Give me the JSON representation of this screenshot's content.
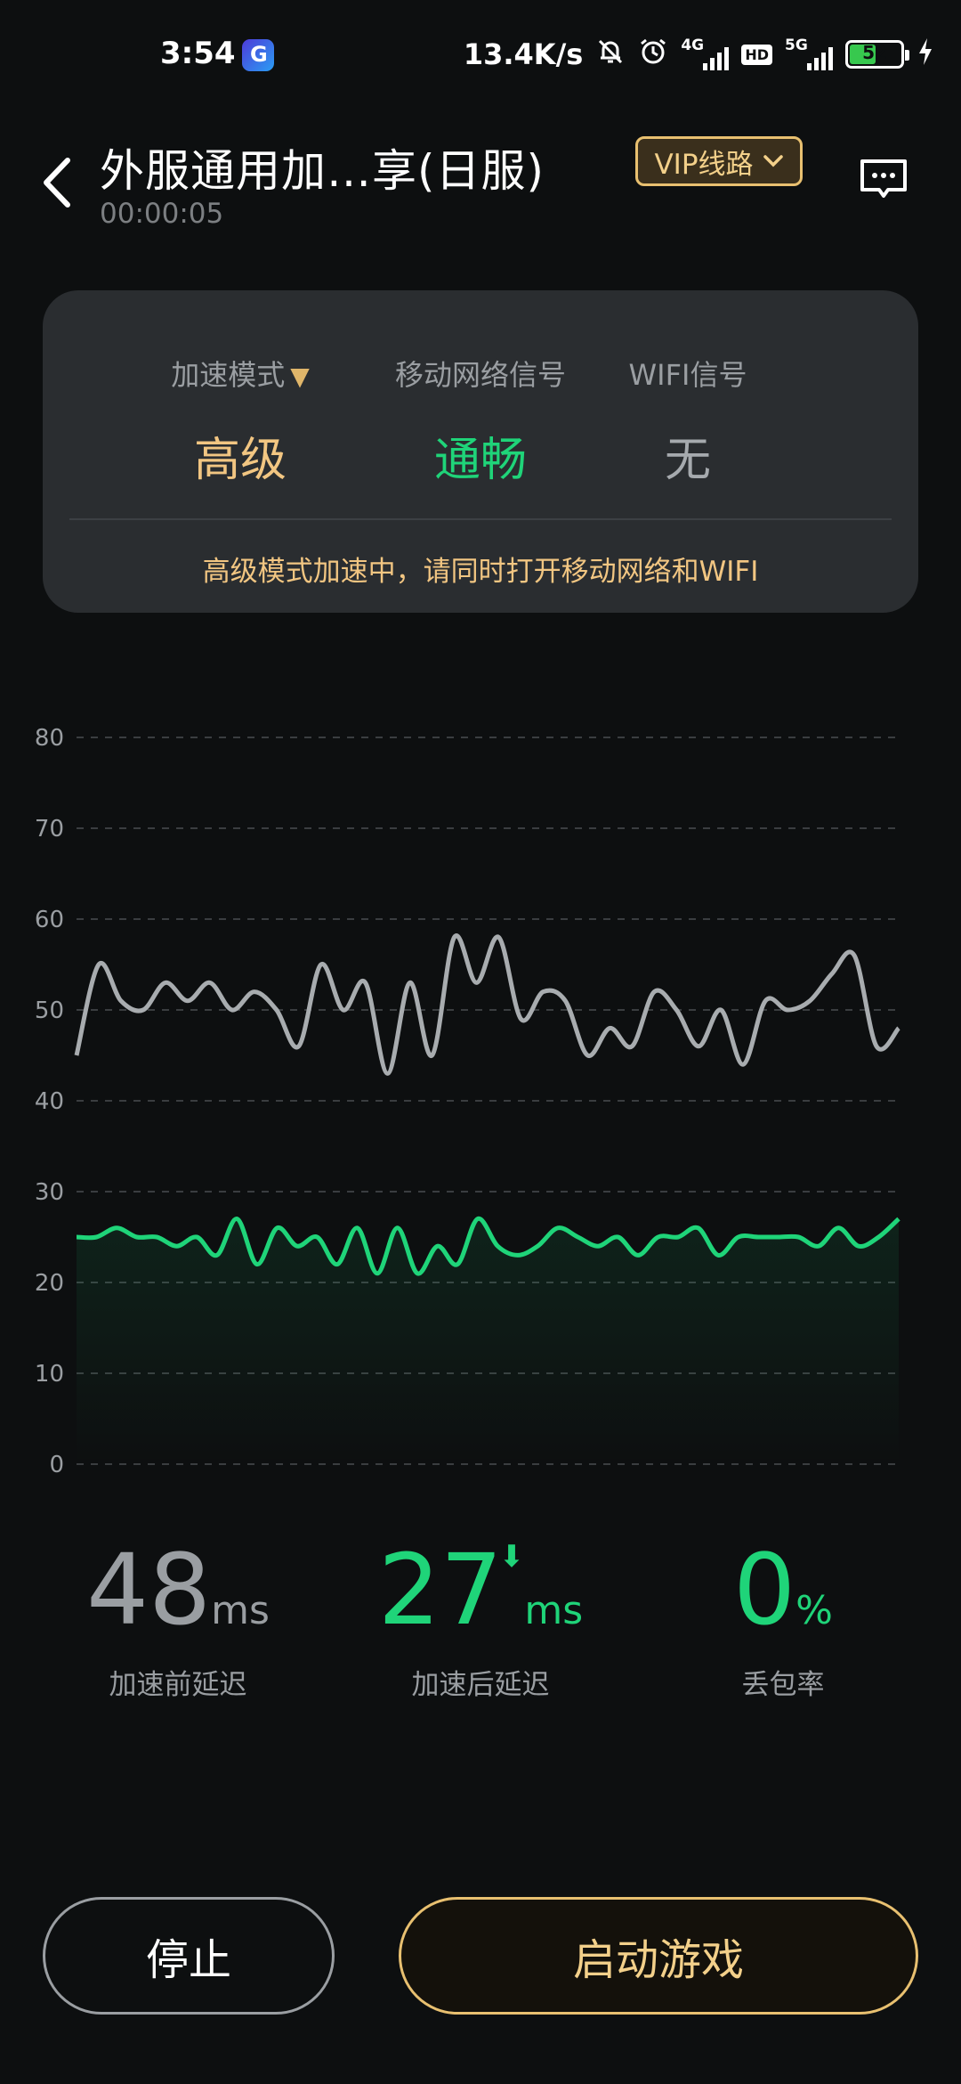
{
  "status_bar": {
    "time": "3:54",
    "net_speed": "13.4K/s",
    "net1": "4G",
    "hd": "HD",
    "net2": "5G",
    "battery": "52",
    "battery_level": 0.52
  },
  "header": {
    "title": "外服通用加…享(日服)",
    "timer": "00:00:05",
    "vip_label": "VIP线路"
  },
  "panel": {
    "mode_label": "加速模式",
    "mode_value": "高级",
    "mobile_label": "移动网络信号",
    "mobile_value": "通畅",
    "wifi_label": "WIFI信号",
    "wifi_value": "无",
    "hint": "高级模式加速中，请同时打开移动网络和WIFI"
  },
  "chart_data": {
    "type": "line",
    "y_ticks": [
      80,
      70,
      60,
      50,
      40,
      30,
      20,
      10,
      0
    ],
    "ylim": [
      0,
      80
    ],
    "grid": true,
    "series": [
      {
        "color": "#a8acaf",
        "values": [
          45,
          55,
          51,
          50,
          53,
          51,
          53,
          50,
          52,
          50,
          46,
          55,
          50,
          53,
          43,
          53,
          45,
          58,
          53,
          58,
          49,
          52,
          51,
          45,
          48,
          46,
          52,
          50,
          46,
          50,
          44,
          51,
          50,
          51,
          54,
          56,
          46,
          48
        ]
      },
      {
        "color": "#1fd479",
        "values": [
          25,
          25,
          26,
          25,
          25,
          24,
          25,
          23,
          27,
          22,
          26,
          24,
          25,
          22,
          26,
          21,
          26,
          21,
          24,
          22,
          27,
          24,
          23,
          24,
          26,
          25,
          24,
          25,
          23,
          25,
          25,
          26,
          23,
          25,
          25,
          25,
          25,
          24,
          26,
          24,
          25,
          27
        ]
      }
    ]
  },
  "stats": {
    "before_value": "48",
    "before_unit": "ms",
    "before_label": "加速前延迟",
    "after_value": "27",
    "after_unit": "ms",
    "after_label": "加速后延迟",
    "loss_value": "0",
    "loss_unit": "%",
    "loss_label": "丢包率"
  },
  "buttons": {
    "stop": "停止",
    "start": "启动游戏"
  }
}
